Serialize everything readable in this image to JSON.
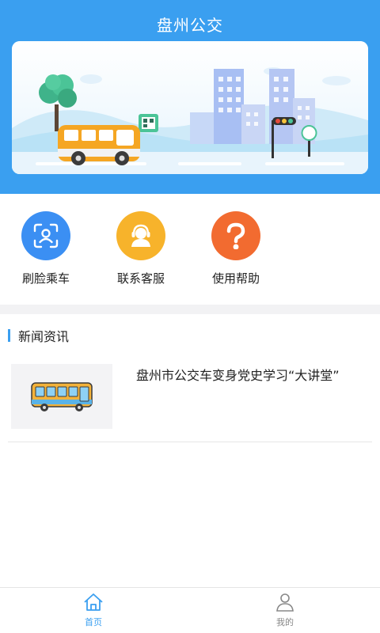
{
  "header": {
    "title": "盘州公交"
  },
  "banner": {
    "name": "bus-city-illustration"
  },
  "quick_actions": [
    {
      "label": "刷脸乘车",
      "icon": "face-scan-icon",
      "color": "#3b8ff3"
    },
    {
      "label": "联系客服",
      "icon": "customer-service-icon",
      "color": "#f7b32b"
    },
    {
      "label": "使用帮助",
      "icon": "help-question-icon",
      "color": "#f26b30"
    }
  ],
  "news": {
    "section_title": "新闻资讯",
    "items": [
      {
        "title": "盘州市公交车变身党史学习“大讲堂”",
        "thumb_icon": "bus-icon"
      }
    ]
  },
  "tabbar": {
    "tabs": [
      {
        "label": "首页",
        "icon": "home-icon",
        "active": true,
        "color": "#3a9ff0"
      },
      {
        "label": "我的",
        "icon": "user-icon",
        "active": false,
        "color": "#888888"
      }
    ]
  }
}
